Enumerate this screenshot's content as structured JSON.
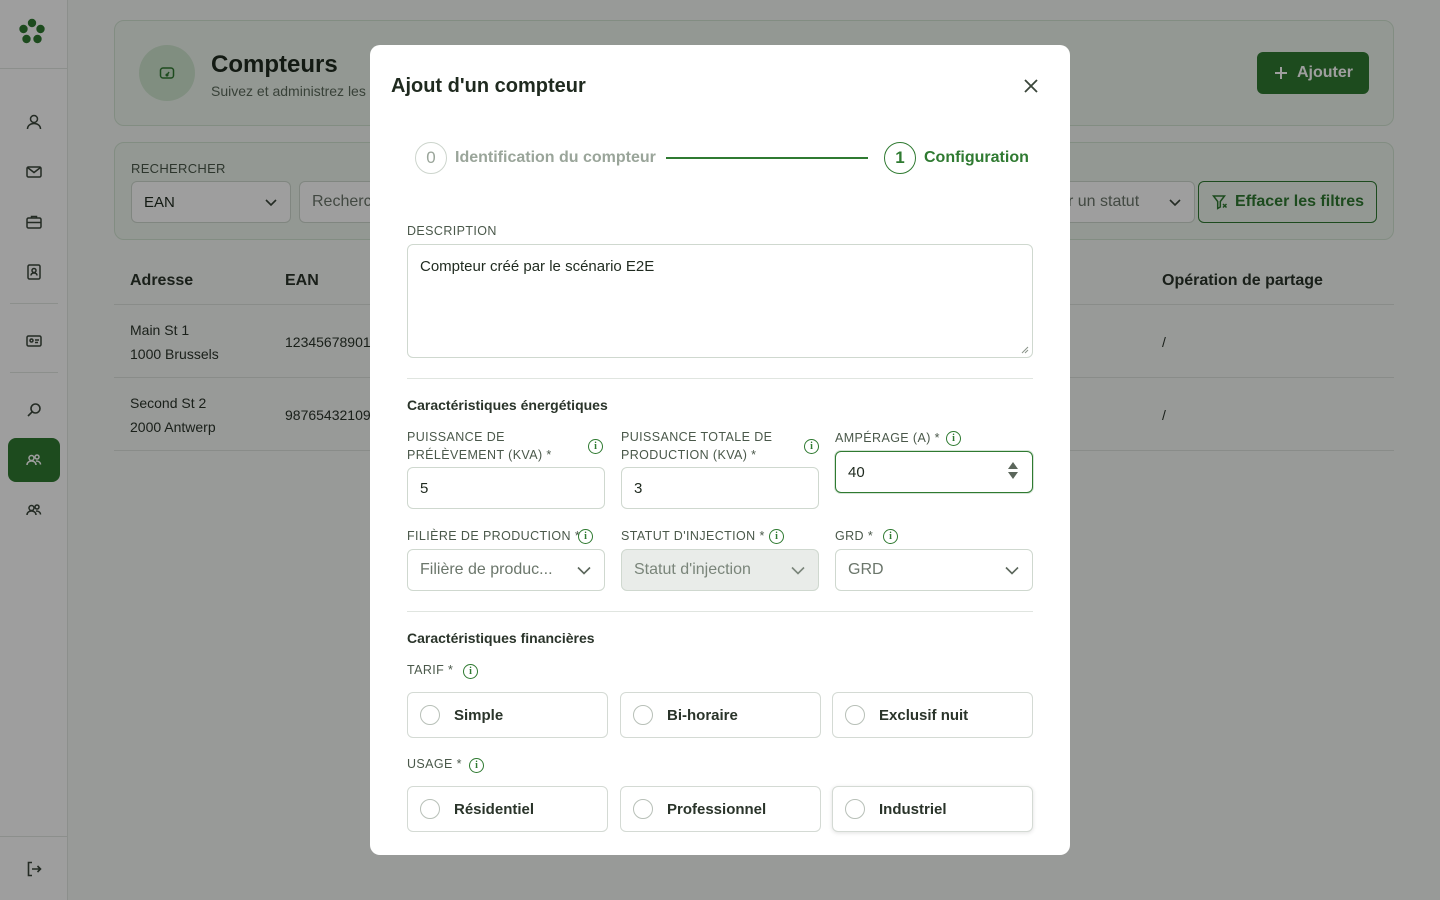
{
  "page": {
    "title": "Compteurs",
    "subtitle": "Suivez et administrez les c",
    "add_label": "Ajouter"
  },
  "filters": {
    "label": "RECHERCHER",
    "field_select": "EAN",
    "search_placeholder": "Recherche",
    "status_placeholder": "r un statut",
    "clear_label": "Effacer les filtres"
  },
  "table": {
    "headers": [
      "Adresse",
      "EAN",
      "Opération de partage"
    ],
    "rows": [
      {
        "address_line1": "Main St 1",
        "address_line2": "1000 Brussels",
        "ean": "12345678901",
        "operation": "/"
      },
      {
        "address_line1": "Second St 2",
        "address_line2": "2000 Antwerp",
        "ean": "98765432109",
        "operation": "/"
      }
    ]
  },
  "modal": {
    "title": "Ajout d'un compteur",
    "steps": [
      {
        "number": "0",
        "label": "Identification du compteur"
      },
      {
        "number": "1",
        "label": "Configuration"
      }
    ],
    "description": {
      "label": "DESCRIPTION",
      "value": "Compteur créé par le scénario E2E"
    },
    "energy": {
      "title": "Caractéristiques énergétiques",
      "power_label_1": "PUISSANCE DE",
      "power_label_2": "PRÉLÈVEMENT (KVA) *",
      "power_value": "5",
      "prod_label_1": "PUISSANCE TOTALE DE",
      "prod_label_2": "PRODUCTION (KVA) *",
      "prod_value": "3",
      "amp_label": "AMPÉRAGE (A) *",
      "amp_value": "40",
      "filiere_label": "FILIÈRE DE PRODUCTION *",
      "filiere_placeholder": "Filière de produc...",
      "injection_label": "STATUT D'INJECTION *",
      "injection_placeholder": "Statut d'injection",
      "grd_label": "GRD *",
      "grd_placeholder": "GRD"
    },
    "financial": {
      "title": "Caractéristiques financières",
      "tarif_label": "TARIF *",
      "tarif_options": [
        "Simple",
        "Bi-horaire",
        "Exclusif nuit"
      ],
      "usage_label": "USAGE *",
      "usage_options": [
        "Résidentiel",
        "Professionnel",
        "Industriel"
      ]
    }
  },
  "colors": {
    "primary": "#2f7a31",
    "overlay": "rgba(0,0,0,0.38)"
  },
  "icons": {
    "sidebar": [
      "user-icon",
      "mail-icon",
      "briefcase-icon",
      "contact-book-icon",
      "id-card-icon",
      "search-icon",
      "community-icon",
      "group-icon",
      "logout-icon"
    ]
  }
}
